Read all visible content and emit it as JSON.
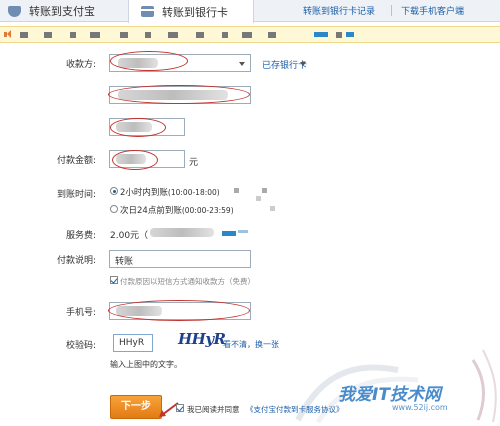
{
  "tabs": {
    "alipay": "转账到支付宝",
    "bankcard": "转账到银行卡"
  },
  "header_links": {
    "records": "转账到银行卡记录",
    "download": "下载手机客户端"
  },
  "form": {
    "payee_label": "收款方:",
    "saved_cards_link": "已存银行卡",
    "amount_label": "付款金额:",
    "amount_unit": "元",
    "arrival_label": "到账时间:",
    "arrival_option1": "2小时内到账",
    "arrival_option1_hours": "(10:00-18:00)",
    "arrival_option2": "次日24点前到账",
    "arrival_option2_hours": "(00:00-23:59)",
    "fee_label": "服务费:",
    "fee_value": "2.00元（",
    "note_label": "付款说明:",
    "note_value": "转账",
    "sms_notify": "付款原因以短信方式通知收款方（免费）",
    "phone_label": "手机号:",
    "captcha_label": "校验码:",
    "captcha_value": "HHyR",
    "captcha_image_text": "HHyR",
    "captcha_refresh": "看不清，换一张",
    "captcha_hint": "输入上图中的文字。",
    "next_button": "下一步",
    "agree_text": "我已阅读并同意",
    "agreement_link": "《支付宝付款到卡服务协议》"
  },
  "watermark": {
    "title": "我爱IT技术网",
    "url": "www.52ij.com"
  },
  "colors": {
    "link": "#1a5ea8",
    "annotation": "#c2322e",
    "next_button": "#f0921f"
  }
}
